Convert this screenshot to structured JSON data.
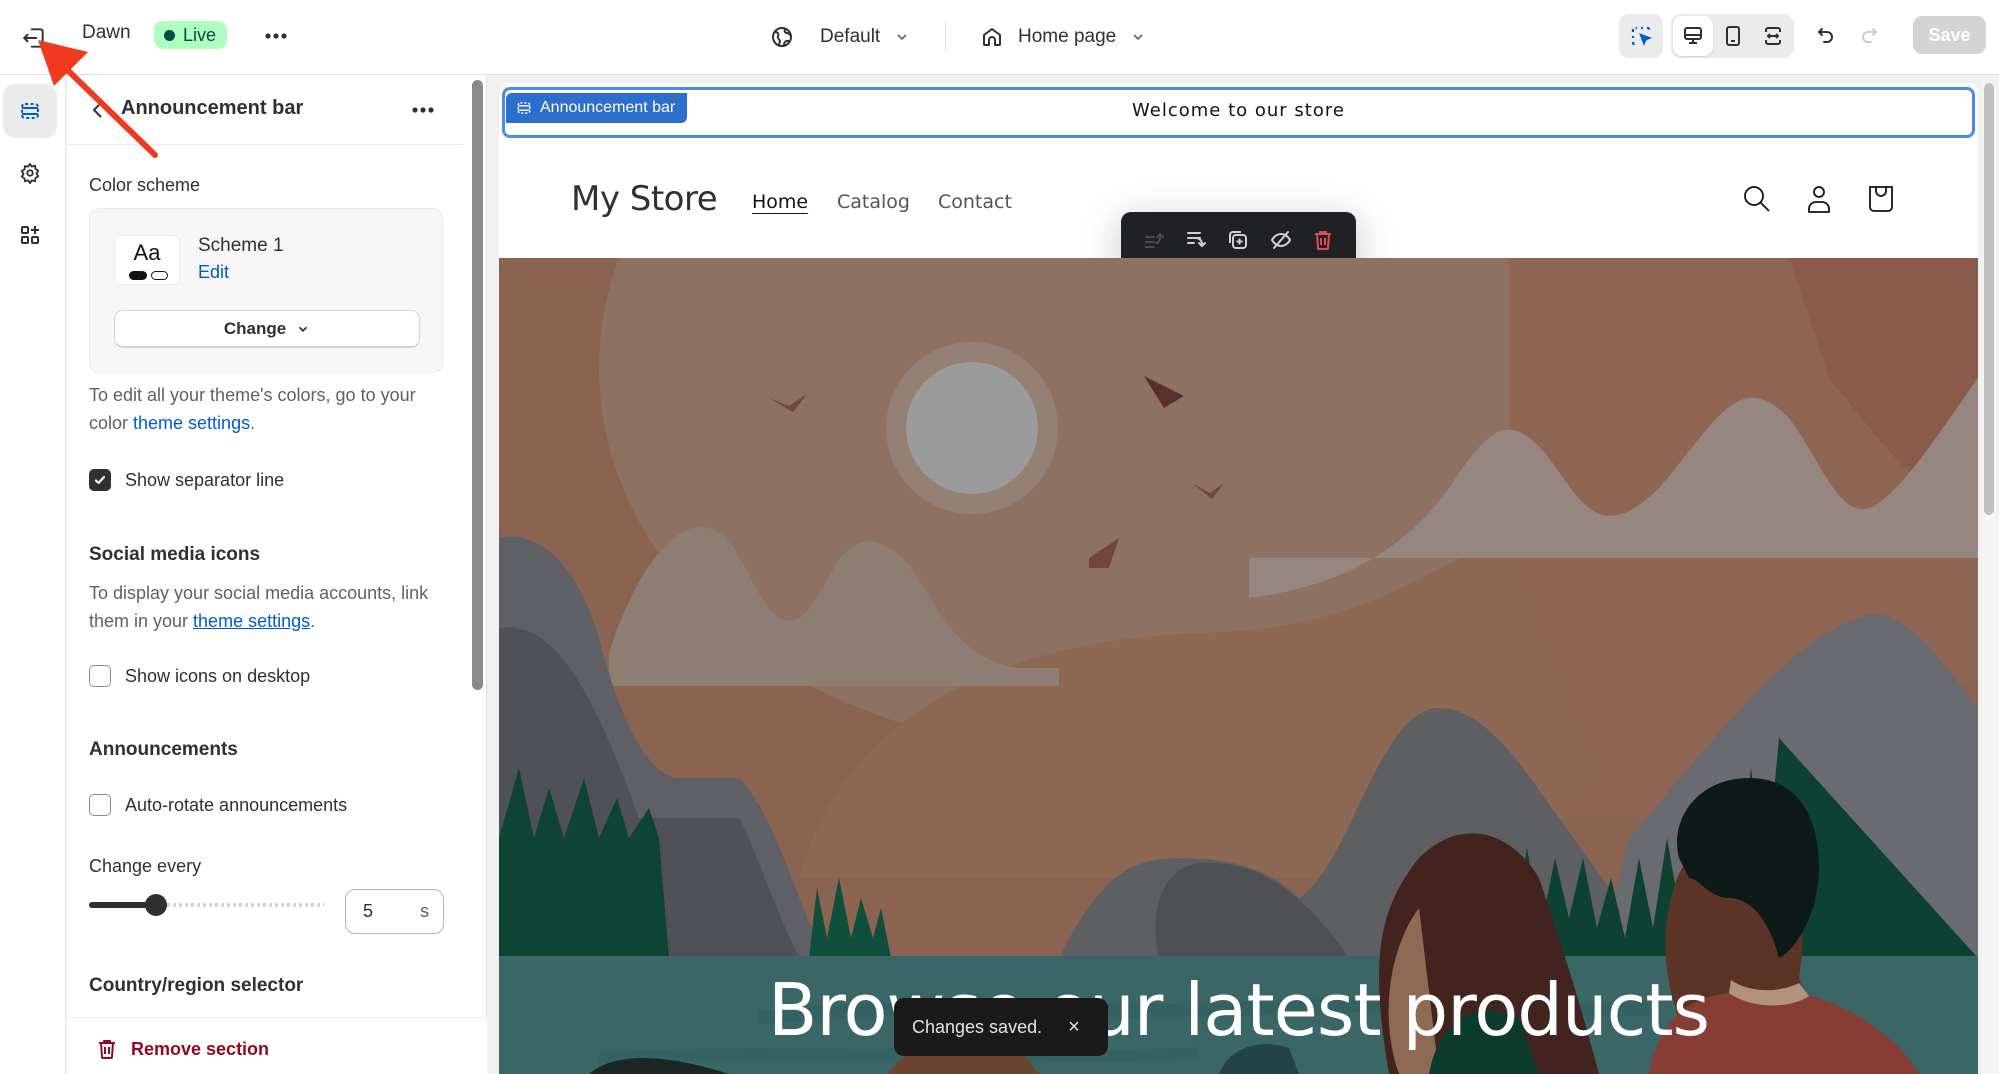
{
  "topbar": {
    "theme_name": "Dawn",
    "status_badge": "Live",
    "market_selector": "Default",
    "page_selector": "Home page",
    "save_label": "Save",
    "icons": [
      "exit-icon",
      "more-horizontal-icon",
      "globe-icon",
      "chevron-down-icon",
      "home-icon",
      "inspector-icon",
      "desktop-icon",
      "mobile-icon",
      "full-width-icon",
      "undo-icon",
      "redo-icon"
    ]
  },
  "rail": {
    "items": [
      {
        "name": "sections",
        "icon": "sections-icon",
        "active": true
      },
      {
        "name": "theme-settings",
        "icon": "gear-icon",
        "active": false
      },
      {
        "name": "app-embeds",
        "icon": "apps-add-icon",
        "active": false
      }
    ]
  },
  "panel": {
    "title": "Announcement bar",
    "color_scheme": {
      "label": "Color scheme",
      "swatch_text": "Aa",
      "scheme_name": "Scheme 1",
      "edit_label": "Edit",
      "change_label": "Change"
    },
    "color_help": {
      "text": "To edit all your theme's colors, go to your color ",
      "link": "theme settings",
      "suffix": "."
    },
    "separator": {
      "label": "Show separator line",
      "checked": true
    },
    "social": {
      "heading": "Social media icons",
      "help_text": "To display your social media accounts, link them in your ",
      "link": "theme settings",
      "suffix": ".",
      "desktop_label": "Show icons on desktop",
      "desktop_checked": false
    },
    "announcements": {
      "heading": "Announcements",
      "autorotate_label": "Auto-rotate announcements",
      "autorotate_checked": false,
      "change_every_label": "Change every",
      "change_every_value": "5",
      "change_every_unit": "s",
      "slider_min": 3,
      "slider_max": 10,
      "slider_value": 5
    },
    "country": {
      "heading": "Country/region selector"
    },
    "remove_label": "Remove section"
  },
  "preview": {
    "section_tag": "Announcement bar",
    "announcement_text": "Welcome to our store",
    "store_name": "My Store",
    "nav": [
      "Home",
      "Catalog",
      "Contact"
    ],
    "nav_active": "Home",
    "header_icons": [
      "search-icon",
      "account-icon",
      "cart-icon"
    ],
    "floating_toolbar": [
      "move-up-icon",
      "move-down-icon",
      "duplicate-icon",
      "hide-icon",
      "delete-icon"
    ],
    "hero_title": "Browse our latest products"
  },
  "toast": {
    "message": "Changes saved.",
    "close": "×"
  },
  "colors": {
    "accent": "#005bd3",
    "live_bg": "#affebf",
    "live_fg": "#014b40",
    "selection_outline": "#4a8af0",
    "critical": "#8e0b21",
    "delete_icon": "#e5484d"
  }
}
